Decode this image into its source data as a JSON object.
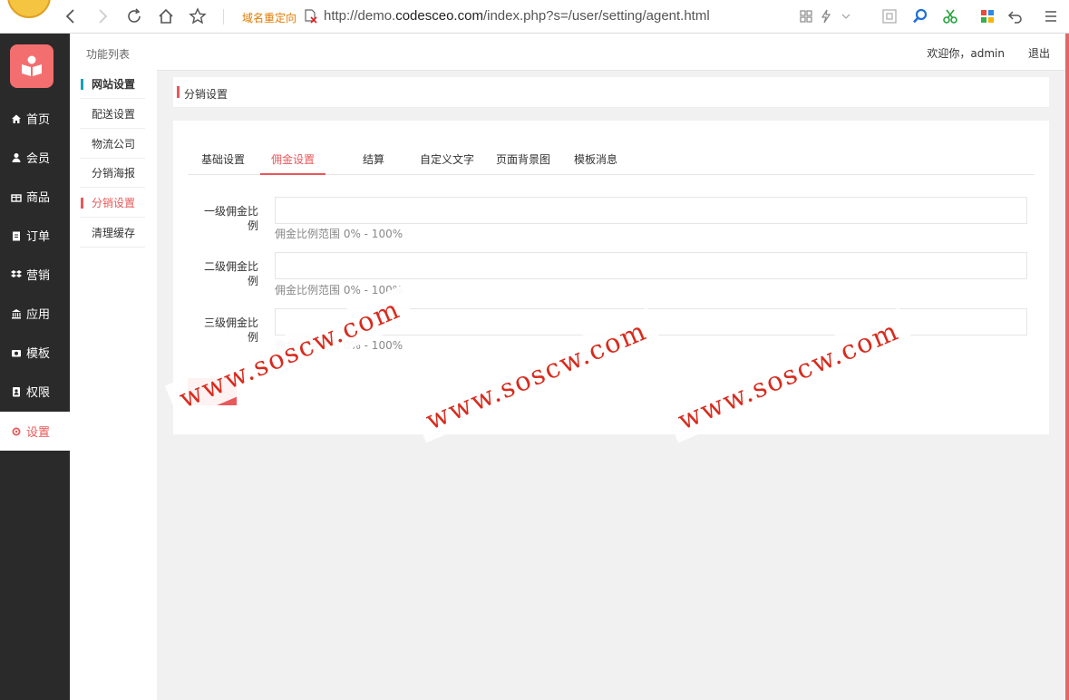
{
  "browser": {
    "redirect_label": "域名重定向",
    "url_prefix": "http://demo.",
    "url_domain": "codesceo.com",
    "url_path": "/index.php?s=/user/setting/agent.html"
  },
  "sidebar": {
    "items": [
      {
        "label": "首页",
        "icon": "home-icon"
      },
      {
        "label": "会员",
        "icon": "user-icon"
      },
      {
        "label": "商品",
        "icon": "gift-icon"
      },
      {
        "label": "订单",
        "icon": "clipboard-icon"
      },
      {
        "label": "营销",
        "icon": "dropbox-icon"
      },
      {
        "label": "应用",
        "icon": "bank-icon"
      },
      {
        "label": "模板",
        "icon": "camera-icon"
      },
      {
        "label": "权限",
        "icon": "id-badge-icon"
      },
      {
        "label": "设置",
        "icon": "gear-icon"
      }
    ]
  },
  "subnav": {
    "title": "功能列表",
    "items": [
      {
        "label": "网站设置"
      },
      {
        "label": "配送设置"
      },
      {
        "label": "物流公司"
      },
      {
        "label": "分销海报"
      },
      {
        "label": "分销设置"
      },
      {
        "label": "清理缓存"
      }
    ]
  },
  "header": {
    "welcome": "欢迎你，admin",
    "logout": "退出"
  },
  "panel": {
    "title": "分销设置"
  },
  "tabs": [
    {
      "label": "基础设置"
    },
    {
      "label": "佣金设置"
    },
    {
      "label": "结算"
    },
    {
      "label": "自定义文字"
    },
    {
      "label": "页面背景图"
    },
    {
      "label": "模板消息"
    }
  ],
  "form": {
    "fields": [
      {
        "label_line1": "一级佣金比",
        "label_line2": "例",
        "value": "",
        "hint": "佣金比例范围 0% - 100%"
      },
      {
        "label_line1": "二级佣金比",
        "label_line2": "例",
        "value": "",
        "hint": "佣金比例范围 0% - 100%"
      },
      {
        "label_line1": "三级佣金比",
        "label_line2": "例",
        "value": "",
        "hint": "佣金比例范围 0% - 100%"
      }
    ]
  },
  "watermark": {
    "text": "www.soscw.com"
  },
  "colors": {
    "accent": "#e9585a",
    "sidebar_bg": "#2a2a2a",
    "group_marker": "#17a2b8"
  }
}
